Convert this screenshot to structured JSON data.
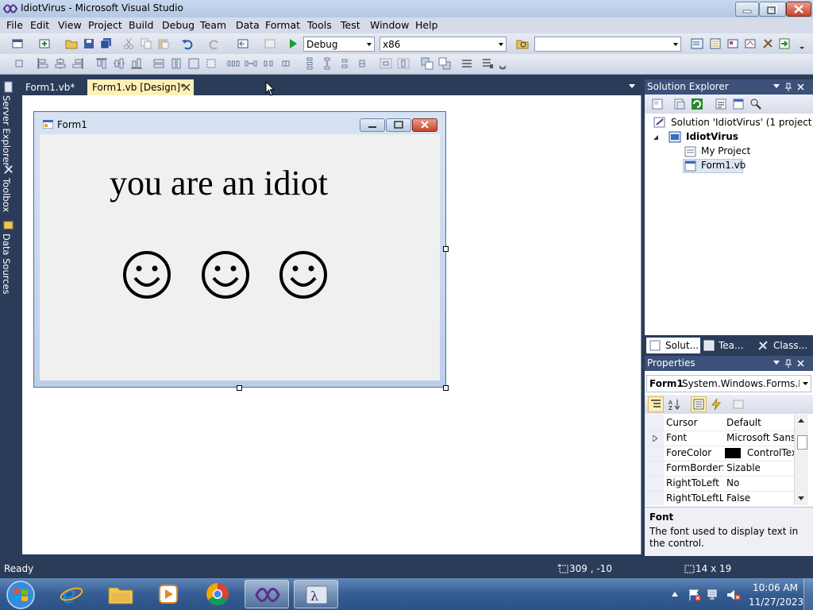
{
  "window": {
    "title": "IdiotVirus - Microsoft Visual Studio"
  },
  "menu": [
    "File",
    "Edit",
    "View",
    "Project",
    "Build",
    "Debug",
    "Team",
    "Data",
    "Format",
    "Tools",
    "Test",
    "Window",
    "Help"
  ],
  "toolbar": {
    "config": "Debug",
    "platform": "x86",
    "find_value": ""
  },
  "left_dock": {
    "tabs": [
      "Server Explorer",
      "Toolbox",
      "Data Sources"
    ]
  },
  "doc_tabs": [
    {
      "label": "Form1.vb*"
    },
    {
      "label": "Form1.vb [Design]*"
    }
  ],
  "form": {
    "title": "Form1",
    "text": "you are an idiot",
    "smileys": [
      "☺",
      "☺",
      "☺"
    ]
  },
  "solution_explorer": {
    "title": "Solution Explorer",
    "tree": [
      {
        "label": "Solution 'IdiotVirus' (1 project)"
      },
      {
        "label": "IdiotVirus"
      },
      {
        "label": "My Project"
      },
      {
        "label": "Form1.vb"
      }
    ],
    "bottom_tabs": [
      "Solut...",
      "Tea...",
      "Class..."
    ]
  },
  "properties": {
    "title": "Properties",
    "object_name": "Form1",
    "object_type": "System.Windows.Forms.Fo",
    "rows": [
      {
        "key": "Cursor",
        "value": "Default"
      },
      {
        "key": "Font",
        "value": "Microsoft Sans S"
      },
      {
        "key": "ForeColor",
        "value": "ControlTex"
      },
      {
        "key": "FormBorderSt",
        "value": "Sizable"
      },
      {
        "key": "RightToLeft",
        "value": "No"
      },
      {
        "key": "RightToLeftLa",
        "value": "False"
      }
    ],
    "desc_title": "Font",
    "desc_text": "The font used to display text in the control."
  },
  "status": {
    "text": "Ready",
    "position": "309 , -10",
    "size": "14 x 19"
  },
  "taskbar": {
    "time": "10:06 AM",
    "date": "11/27/2023"
  },
  "colors": {
    "accent": "#2b3c59",
    "active_tab": "#fff0b6",
    "menu_bg": "#d6dbe9"
  }
}
